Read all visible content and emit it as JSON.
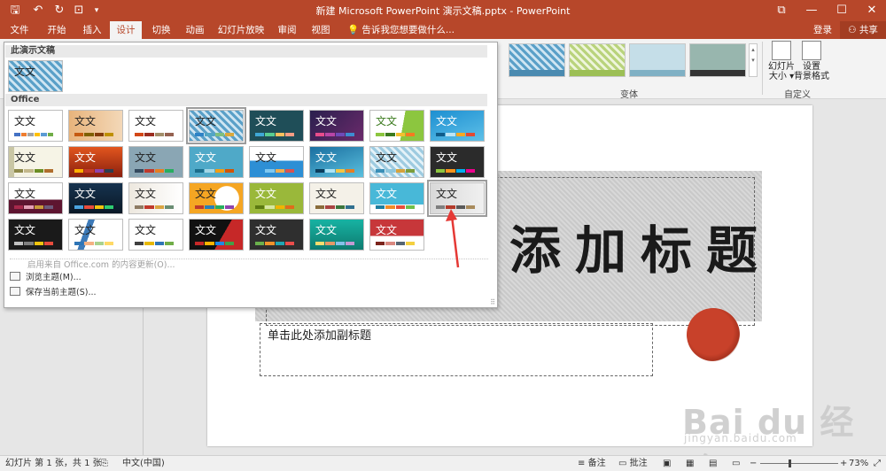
{
  "window": {
    "title": "新建 Microsoft PowerPoint 演示文稿.pptx - PowerPoint",
    "buttons": {
      "restore": "⧉",
      "minimize": "—",
      "maximize": "☐",
      "close": "✕"
    }
  },
  "ribbon": {
    "tabs": [
      "文件",
      "开始",
      "插入",
      "设计",
      "切换",
      "动画",
      "幻灯片放映",
      "审阅",
      "视图"
    ],
    "active_tab": "设计",
    "tell_me": "告诉我您想要做什么...",
    "login": "登录",
    "share": "共享",
    "variants_group": "变体",
    "customize_group": "自定义",
    "slide_size": "幻灯片\n大小 ▾",
    "format_background": "设置\n背景格式"
  },
  "theme_dropdown": {
    "this_presentation_header": "此演示文稿",
    "office_header": "Office",
    "theme_text": "文文",
    "update_link": "启用来自 Office.com 的内容更新(O)...",
    "browse": "浏览主题(M)...",
    "save": "保存当前主题(S)..."
  },
  "slide": {
    "title": "添加标题",
    "subtitle": "单击此处添加副标题"
  },
  "watermark": {
    "brand": "Bai du 经验",
    "url": "jingyan.baidu.com"
  },
  "status": {
    "slide_info": "幻灯片 第 1 张，共 1 张",
    "language": "中文(中国)",
    "notes": "备注",
    "comments": "批注",
    "zoom": "73%",
    "zoom_level": 0.73
  },
  "colors": {
    "accent": "#b7472a",
    "arrow": "#e53935"
  }
}
